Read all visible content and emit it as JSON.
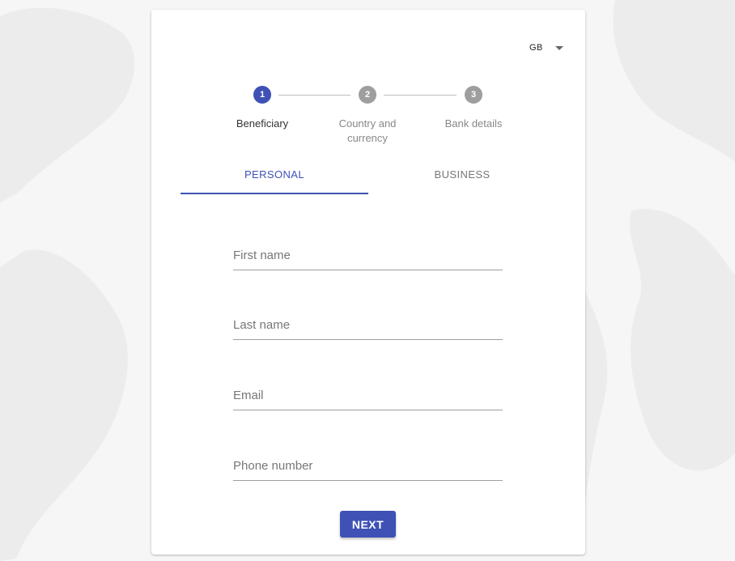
{
  "language": {
    "value": "GB",
    "icon": "caret-down-icon"
  },
  "stepper": {
    "steps": [
      {
        "number": "1",
        "label": "Beneficiary",
        "active": true
      },
      {
        "number": "2",
        "label_line1": "Country and",
        "label_line2": "currency",
        "active": false
      },
      {
        "number": "3",
        "label": "Bank details",
        "active": false
      }
    ]
  },
  "tabs": [
    {
      "label": "PERSONAL",
      "active": true
    },
    {
      "label": "BUSINESS",
      "active": false
    }
  ],
  "form": {
    "first_name": {
      "placeholder": "First name",
      "value": ""
    },
    "last_name": {
      "placeholder": "Last name",
      "value": ""
    },
    "email": {
      "placeholder": "Email",
      "value": ""
    },
    "phone": {
      "placeholder": "Phone number",
      "value": ""
    }
  },
  "actions": {
    "next_label": "NEXT"
  },
  "colors": {
    "primary": "#3f51b5",
    "inactive_step": "#9e9e9e",
    "background": "#f6f6f6"
  }
}
